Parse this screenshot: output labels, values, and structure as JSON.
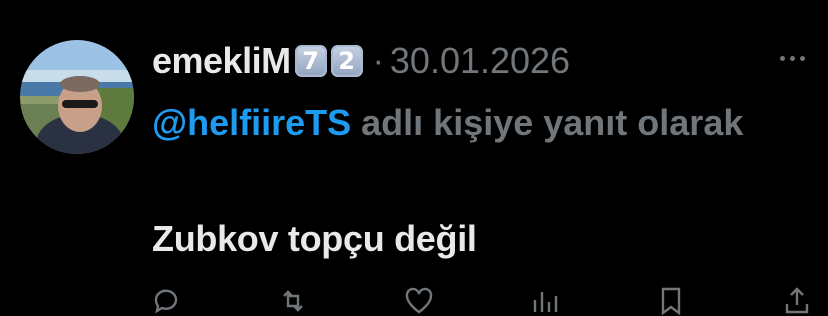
{
  "tweet": {
    "display_name": "emekliM",
    "badge_digits": [
      "7",
      "2"
    ],
    "separator": "·",
    "date": "30.01.2026",
    "reply_mention": "@helfiireTS",
    "reply_suffix": " adlı kişiye yanıt olarak",
    "text": "Zubkov topçu değil"
  },
  "icons": {
    "more": "more-dots-icon",
    "actions": [
      "reply-icon",
      "retweet-icon",
      "like-icon",
      "views-icon",
      "bookmark-icon",
      "share-icon"
    ]
  },
  "colors": {
    "background": "#000000",
    "text": "#e7e9ea",
    "secondary": "#71767b",
    "link": "#1d9bf0"
  }
}
